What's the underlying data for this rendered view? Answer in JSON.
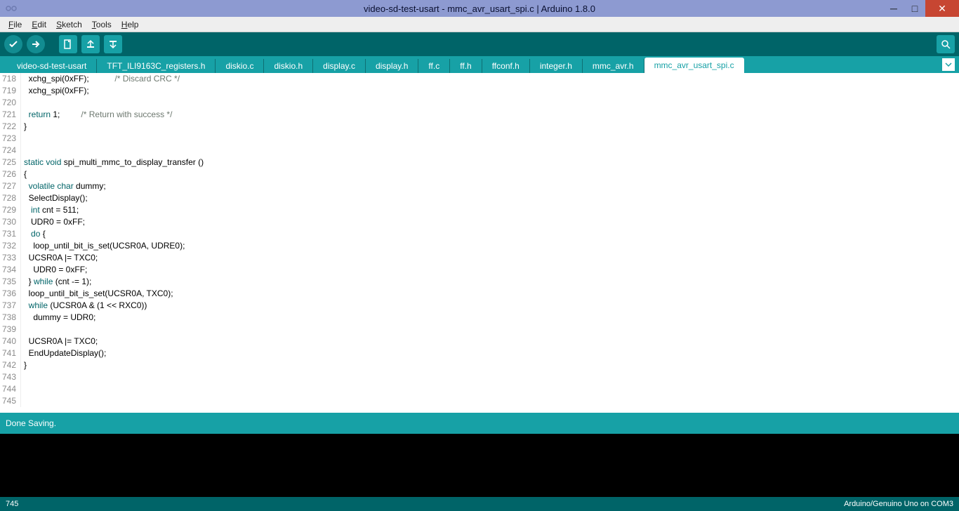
{
  "title": "video-sd-test-usart - mmc_avr_usart_spi.c | Arduino 1.8.0",
  "menu": {
    "items": [
      "File",
      "Edit",
      "Sketch",
      "Tools",
      "Help"
    ]
  },
  "tabs": [
    "video-sd-test-usart",
    "TFT_ILI9163C_registers.h",
    "diskio.c",
    "diskio.h",
    "display.c",
    "display.h",
    "ff.c",
    "ff.h",
    "ffconf.h",
    "integer.h",
    "mmc_avr.h",
    "mmc_avr_usart_spi.c"
  ],
  "active_tab": 11,
  "code_lines": [
    {
      "n": 718,
      "segs": [
        {
          "t": "  xchg_spi(0xFF);           ",
          "c": "plain"
        },
        {
          "t": "/* Discard CRC */",
          "c": "comment"
        }
      ]
    },
    {
      "n": 719,
      "segs": [
        {
          "t": "  xchg_spi(0xFF);",
          "c": "plain"
        }
      ]
    },
    {
      "n": 720,
      "segs": []
    },
    {
      "n": 721,
      "segs": [
        {
          "t": "  ",
          "c": "plain"
        },
        {
          "t": "return",
          "c": "kw1"
        },
        {
          "t": " 1;         ",
          "c": "plain"
        },
        {
          "t": "/* Return with success */",
          "c": "comment"
        }
      ]
    },
    {
      "n": 722,
      "segs": [
        {
          "t": "}",
          "c": "plain"
        }
      ]
    },
    {
      "n": 723,
      "segs": []
    },
    {
      "n": 724,
      "segs": []
    },
    {
      "n": 725,
      "segs": [
        {
          "t": "static",
          "c": "kw1"
        },
        {
          "t": " ",
          "c": "plain"
        },
        {
          "t": "void",
          "c": "kw1"
        },
        {
          "t": " spi_multi_mmc_to_display_transfer ()",
          "c": "plain"
        }
      ]
    },
    {
      "n": 726,
      "segs": [
        {
          "t": "{",
          "c": "plain"
        }
      ]
    },
    {
      "n": 727,
      "segs": [
        {
          "t": "  ",
          "c": "plain"
        },
        {
          "t": "volatile",
          "c": "kw1"
        },
        {
          "t": " ",
          "c": "plain"
        },
        {
          "t": "char",
          "c": "kw1"
        },
        {
          "t": " dummy;",
          "c": "plain"
        }
      ]
    },
    {
      "n": 728,
      "segs": [
        {
          "t": "  SelectDisplay();",
          "c": "plain"
        }
      ]
    },
    {
      "n": 729,
      "segs": [
        {
          "t": "   ",
          "c": "plain"
        },
        {
          "t": "int",
          "c": "kw1"
        },
        {
          "t": " cnt = 511;",
          "c": "plain"
        }
      ]
    },
    {
      "n": 730,
      "segs": [
        {
          "t": "   UDR0 = 0xFF;",
          "c": "plain"
        }
      ]
    },
    {
      "n": 731,
      "segs": [
        {
          "t": "   ",
          "c": "plain"
        },
        {
          "t": "do",
          "c": "kw1"
        },
        {
          "t": " {",
          "c": "plain"
        }
      ]
    },
    {
      "n": 732,
      "segs": [
        {
          "t": "    loop_until_bit_is_set(UCSR0A, UDRE0);",
          "c": "plain"
        }
      ]
    },
    {
      "n": 733,
      "segs": [
        {
          "t": "  UCSR0A |= TXC0;",
          "c": "plain"
        }
      ]
    },
    {
      "n": 734,
      "segs": [
        {
          "t": "    UDR0 = 0xFF;",
          "c": "plain"
        }
      ]
    },
    {
      "n": 735,
      "segs": [
        {
          "t": "  } ",
          "c": "plain"
        },
        {
          "t": "while",
          "c": "kw1"
        },
        {
          "t": " (cnt -= 1);",
          "c": "plain"
        }
      ]
    },
    {
      "n": 736,
      "segs": [
        {
          "t": "  loop_until_bit_is_set(UCSR0A, TXC0);",
          "c": "plain"
        }
      ]
    },
    {
      "n": 737,
      "segs": [
        {
          "t": "  ",
          "c": "plain"
        },
        {
          "t": "while",
          "c": "kw1"
        },
        {
          "t": " (UCSR0A & (1 << RXC0))",
          "c": "plain"
        }
      ]
    },
    {
      "n": 738,
      "segs": [
        {
          "t": "    dummy = UDR0;",
          "c": "plain"
        }
      ]
    },
    {
      "n": 739,
      "segs": []
    },
    {
      "n": 740,
      "segs": [
        {
          "t": "  UCSR0A |= TXC0;",
          "c": "plain"
        }
      ]
    },
    {
      "n": 741,
      "segs": [
        {
          "t": "  EndUpdateDisplay();",
          "c": "plain"
        }
      ]
    },
    {
      "n": 742,
      "segs": [
        {
          "t": "}",
          "c": "plain"
        }
      ]
    },
    {
      "n": 743,
      "segs": []
    },
    {
      "n": 744,
      "segs": []
    },
    {
      "n": 745,
      "segs": []
    }
  ],
  "status": "Done Saving.",
  "bottom": {
    "left": "745",
    "right": "Arduino/Genuino Uno on COM3"
  }
}
